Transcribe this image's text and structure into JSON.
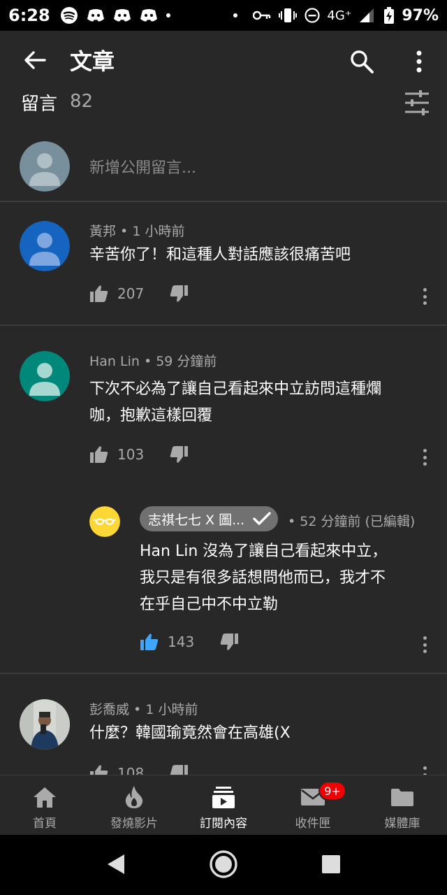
{
  "status_bar": {
    "time": "6:28",
    "network": "4G⁺",
    "battery": "97%",
    "icons": [
      "spotify-icon",
      "discord-icon",
      "discord-icon",
      "discord-icon",
      "vpn-key-icon",
      "vibrate-icon",
      "do-not-disturb-icon",
      "signal-icon",
      "battery-charging-icon"
    ]
  },
  "app_bar": {
    "title": "文章",
    "icons": [
      "back-arrow-icon",
      "search-icon",
      "more-vert-icon"
    ]
  },
  "comments_header": {
    "label": "留言",
    "count": "82",
    "icon": "sort-filter-icon"
  },
  "add_comment": {
    "placeholder": "新增公開留言..."
  },
  "comments": [
    {
      "author": "黃邦",
      "time": "1 小時前",
      "text": "辛苦你了！和這種人對話應該很痛苦吧",
      "likes": "207",
      "avatar_color": "#1565c0",
      "avatar_fg": "#7ea7df"
    },
    {
      "author": "Han Lin",
      "time": "59 分鐘前",
      "text_lines": [
        "下次不必為了讓自己看起來中立訪問這種爛",
        "咖，抱歉這樣回覆"
      ],
      "likes": "103",
      "avatar_color": "#00897b",
      "avatar_fg": "#a6d7d0",
      "reply": {
        "author_chip": "志祺七七 X 圖...",
        "time": "52 分鐘前 (已編輯)",
        "text_lines": [
          "Han Lin 沒為了讓自己看起來中立，",
          "我只是有很多話想問他而已，我才不",
          "在乎自己中不中立勒"
        ],
        "likes": "143",
        "liked_color": "#3ea6ff",
        "avatar_color": "#fdd835"
      }
    },
    {
      "author": "彭喬威",
      "time": "1 小時前",
      "text": "什麼？韓國瑜竟然會在高雄(X",
      "likes": "108"
    }
  ],
  "bottom_nav": {
    "items": [
      {
        "label": "首頁",
        "icon": "home-icon"
      },
      {
        "label": "發燒影片",
        "icon": "trending-fire-icon"
      },
      {
        "label": "訂閱內容",
        "icon": "subscriptions-icon",
        "active": true
      },
      {
        "label": "收件匣",
        "icon": "inbox-mail-icon",
        "badge": "9+"
      },
      {
        "label": "媒體庫",
        "icon": "library-folder-icon"
      }
    ]
  },
  "system_nav": {
    "icons": [
      "back-triangle-icon",
      "home-circle-icon",
      "recents-square-icon"
    ]
  },
  "colors": {
    "background": "#282828",
    "secondary_text": "#aaaaaa",
    "badge_red": "#ee0000",
    "placeholder_avatar": "#78909c"
  }
}
